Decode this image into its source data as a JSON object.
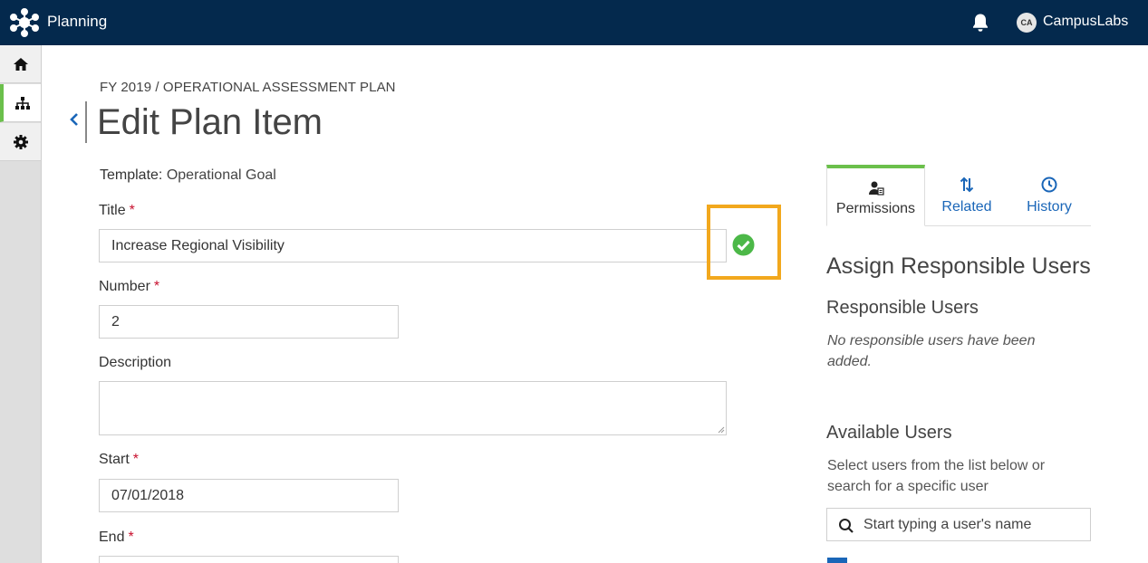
{
  "topbar": {
    "app_name": "Planning",
    "avatar_initials": "CA",
    "user_name": "CampusLabs",
    "bg_color": "#04294d"
  },
  "rail": {
    "items": [
      {
        "name": "home",
        "icon": "home-icon"
      },
      {
        "name": "hierarchy",
        "icon": "sitemap-icon",
        "active": true
      },
      {
        "name": "settings",
        "icon": "gear-icon"
      }
    ]
  },
  "header": {
    "breadcrumb": "FY 2019 / OPERATIONAL ASSESSMENT PLAN",
    "title": "Edit Plan Item"
  },
  "form": {
    "template_label": "Template:",
    "template_value": "Operational Goal",
    "title_label": "Title",
    "title_value": "Increase Regional Visibility",
    "number_label": "Number",
    "number_value": "2",
    "description_label": "Description",
    "description_value": "",
    "start_label": "Start",
    "start_value": "07/01/2018",
    "end_label": "End",
    "end_value": "",
    "required_mark": "*"
  },
  "panel": {
    "tabs": [
      {
        "label": "Permissions",
        "icon": "user-permissions-icon",
        "active": true
      },
      {
        "label": "Related",
        "icon": "sort-arrows-icon",
        "active": false
      },
      {
        "label": "History",
        "icon": "clock-icon",
        "active": false
      }
    ],
    "heading": "Assign Responsible Users",
    "responsible_heading": "Responsible Users",
    "responsible_empty": "No responsible users have been added.",
    "available_heading": "Available Users",
    "available_help": "Select users from the list below or search for a specific user",
    "search_placeholder": "Start typing a user's name"
  },
  "colors": {
    "accent_green": "#6bc04b",
    "link_blue": "#1a66b8",
    "required_red": "#c8102e",
    "highlight_orange": "#f2a81d",
    "check_green": "#4cb848"
  }
}
